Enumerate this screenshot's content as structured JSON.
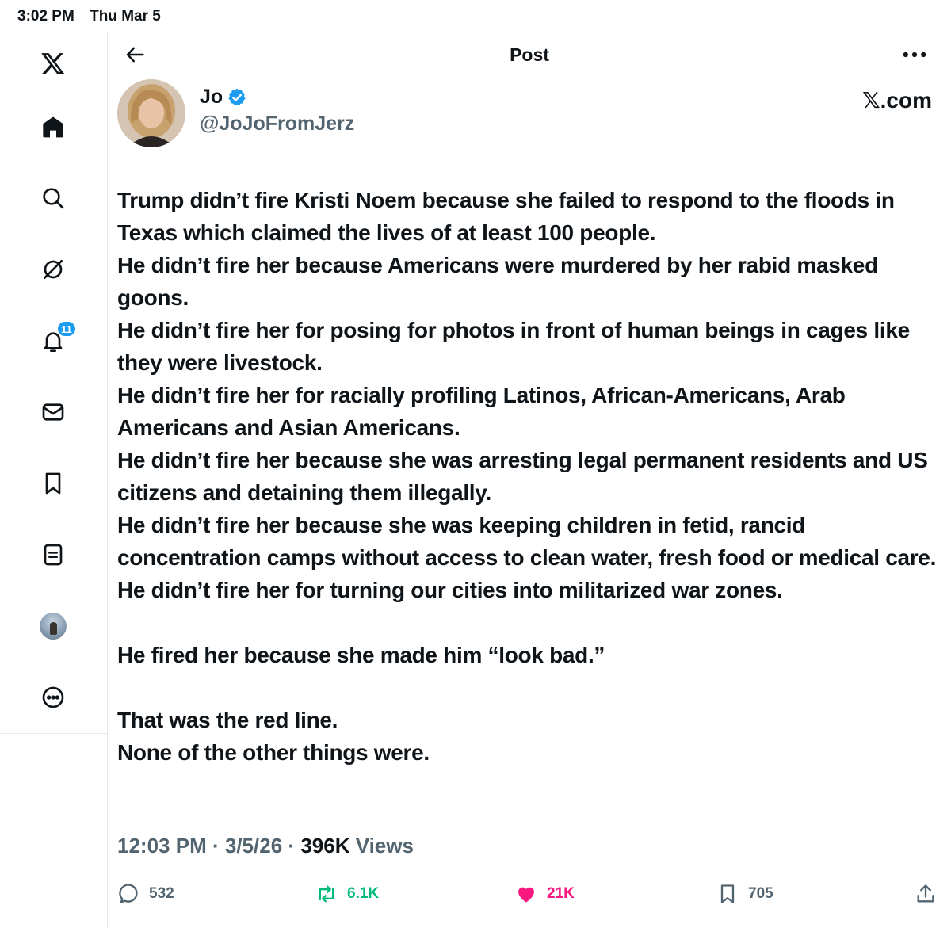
{
  "status_bar": {
    "time": "3:02 PM",
    "date": "Thu Mar 5"
  },
  "header": {
    "title": "Post"
  },
  "author": {
    "name": "Jo",
    "handle": "@JoJoFromJerz",
    "source": "𝕏.com"
  },
  "sidebar": {
    "notification_count": "11"
  },
  "post": {
    "paragraphs": [
      "Trump didn’t fire Kristi Noem because she failed to respond to the floods in Texas which claimed the lives of at least 100 people.",
      "He didn’t fire her because Americans were murdered by her rabid masked goons.",
      "He didn’t fire her for posing for photos in front of human beings in cages like they were livestock.",
      "He didn’t fire her for racially profiling Latinos, African-Americans, Arab Americans and Asian Americans.",
      "He didn’t fire her because she was arresting legal permanent residents and US citizens and detaining them illegally.",
      "He didn’t fire her because she was keeping children in fetid, rancid concentration camps without access to clean water, fresh food or medical care.",
      "He didn’t fire her for turning our cities into militarized war zones.",
      "He fired her because she made him “look bad.”",
      "That was the red line.",
      "None of the other things were."
    ]
  },
  "meta": {
    "time": "12:03 PM",
    "date": "3/5/26",
    "views_count": "396K",
    "views_label": "Views",
    "separator": "·"
  },
  "actions": {
    "replies": "532",
    "reposts": "6.1K",
    "likes": "21K",
    "bookmarks": "705"
  },
  "colors": {
    "accent": "#1d9bf0",
    "repost": "#00ba7c",
    "like": "#f91880",
    "muted": "#536471"
  }
}
